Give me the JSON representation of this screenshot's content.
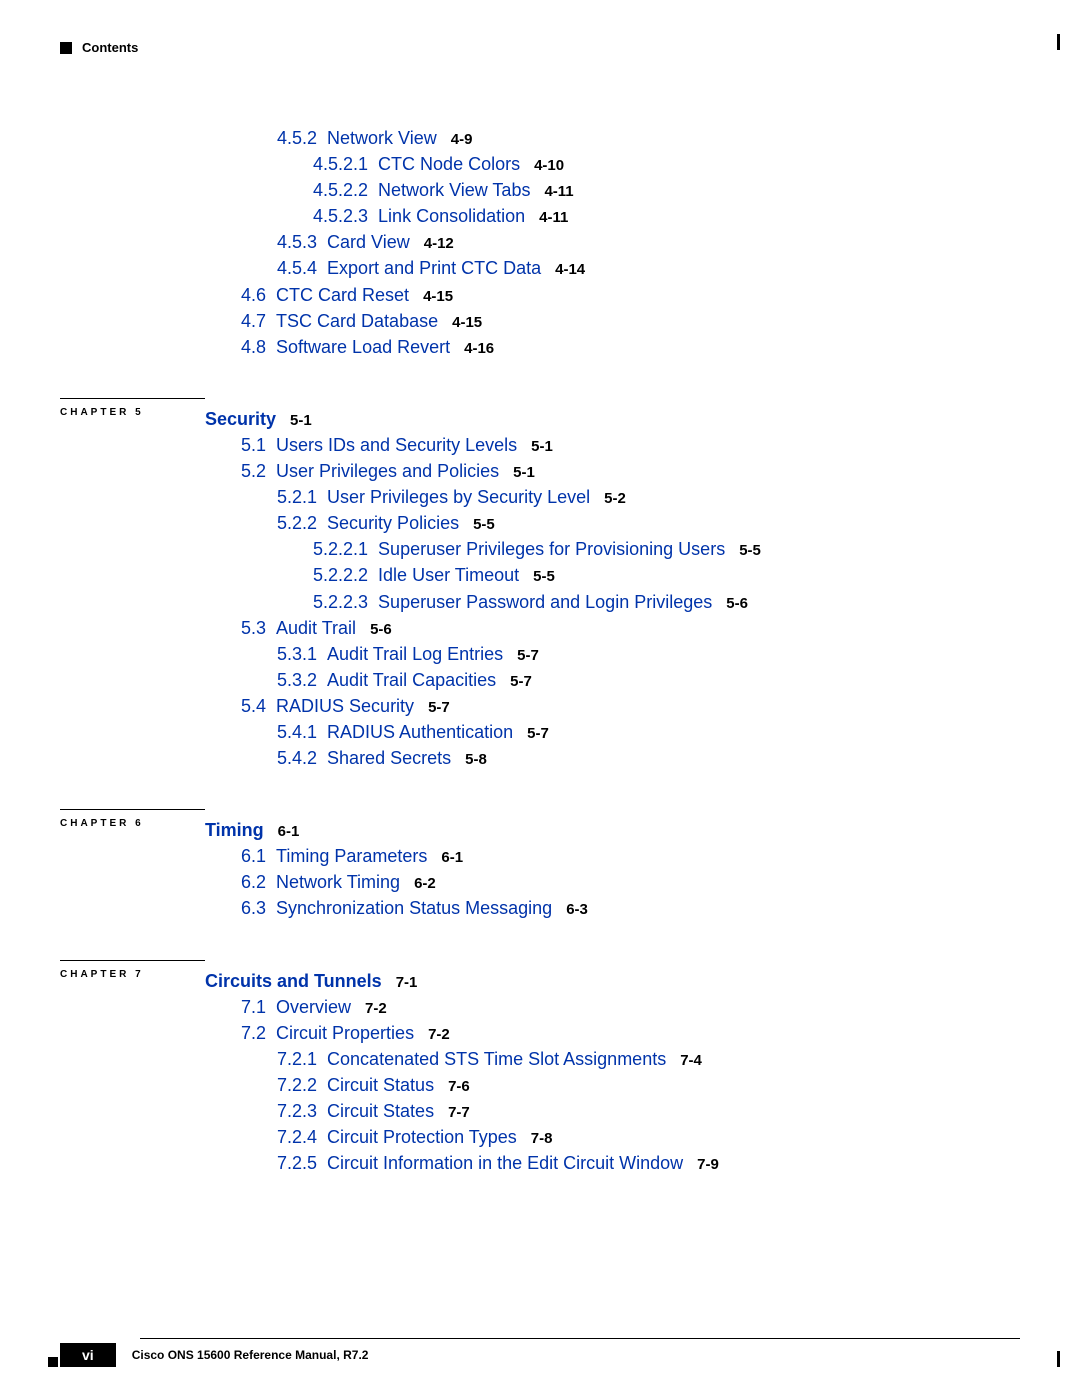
{
  "header": {
    "label": "Contents"
  },
  "continuation": [
    {
      "indent": 2,
      "num": "4.5.2",
      "title": "Network View",
      "page": "4-9"
    },
    {
      "indent": 3,
      "num": "4.5.2.1",
      "title": "CTC Node Colors",
      "page": "4-10"
    },
    {
      "indent": 3,
      "num": "4.5.2.2",
      "title": "Network View Tabs",
      "page": "4-11"
    },
    {
      "indent": 3,
      "num": "4.5.2.3",
      "title": "Link Consolidation",
      "page": "4-11"
    },
    {
      "indent": 2,
      "num": "4.5.3",
      "title": "Card View",
      "page": "4-12"
    },
    {
      "indent": 2,
      "num": "4.5.4",
      "title": "Export and Print CTC Data",
      "page": "4-14"
    },
    {
      "indent": 1,
      "num": "4.6",
      "title": "CTC Card Reset",
      "page": "4-15"
    },
    {
      "indent": 1,
      "num": "4.7",
      "title": "TSC Card Database",
      "page": "4-15"
    },
    {
      "indent": 1,
      "num": "4.8",
      "title": "Software Load Revert",
      "page": "4-16"
    }
  ],
  "chapters": [
    {
      "label": "CHAPTER 5",
      "title": "Security",
      "page": "5-1",
      "entries": [
        {
          "indent": 1,
          "num": "5.1",
          "title": "Users IDs and Security Levels",
          "page": "5-1"
        },
        {
          "indent": 1,
          "num": "5.2",
          "title": "User Privileges and Policies",
          "page": "5-1"
        },
        {
          "indent": 2,
          "num": "5.2.1",
          "title": "User Privileges by Security Level",
          "page": "5-2"
        },
        {
          "indent": 2,
          "num": "5.2.2",
          "title": "Security Policies",
          "page": "5-5"
        },
        {
          "indent": 3,
          "num": "5.2.2.1",
          "title": "Superuser Privileges for Provisioning Users",
          "page": "5-5"
        },
        {
          "indent": 3,
          "num": "5.2.2.2",
          "title": "Idle User Timeout",
          "page": "5-5"
        },
        {
          "indent": 3,
          "num": "5.2.2.3",
          "title": "Superuser Password and Login Privileges",
          "page": "5-6"
        },
        {
          "indent": 1,
          "num": "5.3",
          "title": "Audit Trail",
          "page": "5-6"
        },
        {
          "indent": 2,
          "num": "5.3.1",
          "title": "Audit Trail Log Entries",
          "page": "5-7"
        },
        {
          "indent": 2,
          "num": "5.3.2",
          "title": "Audit Trail Capacities",
          "page": "5-7"
        },
        {
          "indent": 1,
          "num": "5.4",
          "title": "RADIUS Security",
          "page": "5-7"
        },
        {
          "indent": 2,
          "num": "5.4.1",
          "title": "RADIUS Authentication",
          "page": "5-7"
        },
        {
          "indent": 2,
          "num": "5.4.2",
          "title": "Shared Secrets",
          "page": "5-8"
        }
      ]
    },
    {
      "label": "CHAPTER 6",
      "title": "Timing",
      "page": "6-1",
      "entries": [
        {
          "indent": 1,
          "num": "6.1",
          "title": "Timing Parameters",
          "page": "6-1"
        },
        {
          "indent": 1,
          "num": "6.2",
          "title": "Network Timing",
          "page": "6-2"
        },
        {
          "indent": 1,
          "num": "6.3",
          "title": "Synchronization Status Messaging",
          "page": "6-3"
        }
      ]
    },
    {
      "label": "CHAPTER 7",
      "title": "Circuits and Tunnels",
      "page": "7-1",
      "entries": [
        {
          "indent": 1,
          "num": "7.1",
          "title": "Overview",
          "page": "7-2"
        },
        {
          "indent": 1,
          "num": "7.2",
          "title": "Circuit Properties",
          "page": "7-2"
        },
        {
          "indent": 2,
          "num": "7.2.1",
          "title": "Concatenated STS Time Slot Assignments",
          "page": "7-4"
        },
        {
          "indent": 2,
          "num": "7.2.2",
          "title": "Circuit Status",
          "page": "7-6"
        },
        {
          "indent": 2,
          "num": "7.2.3",
          "title": "Circuit States",
          "page": "7-7"
        },
        {
          "indent": 2,
          "num": "7.2.4",
          "title": "Circuit Protection Types",
          "page": "7-8"
        },
        {
          "indent": 2,
          "num": "7.2.5",
          "title": "Circuit Information in the Edit Circuit Window",
          "page": "7-9"
        }
      ]
    }
  ],
  "footer": {
    "manual_title": "Cisco ONS 15600 Reference Manual, R7.2",
    "page_number": "vi"
  }
}
